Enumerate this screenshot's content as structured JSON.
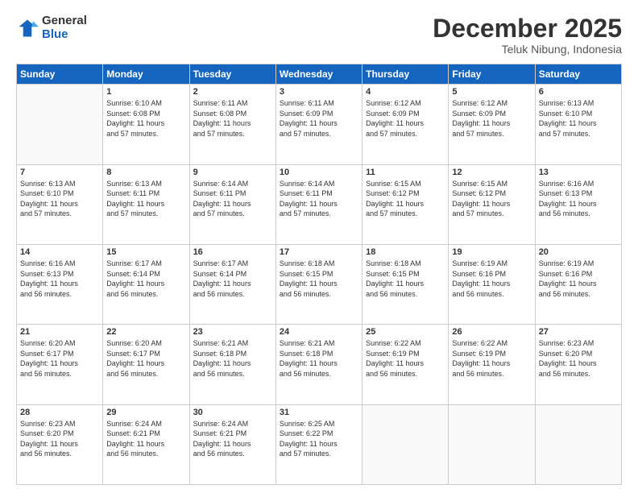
{
  "logo": {
    "general": "General",
    "blue": "Blue"
  },
  "title": "December 2025",
  "subtitle": "Teluk Nibung, Indonesia",
  "weekdays": [
    "Sunday",
    "Monday",
    "Tuesday",
    "Wednesday",
    "Thursday",
    "Friday",
    "Saturday"
  ],
  "weeks": [
    [
      {
        "day": "",
        "info": ""
      },
      {
        "day": "1",
        "info": "Sunrise: 6:10 AM\nSunset: 6:08 PM\nDaylight: 11 hours\nand 57 minutes."
      },
      {
        "day": "2",
        "info": "Sunrise: 6:11 AM\nSunset: 6:08 PM\nDaylight: 11 hours\nand 57 minutes."
      },
      {
        "day": "3",
        "info": "Sunrise: 6:11 AM\nSunset: 6:09 PM\nDaylight: 11 hours\nand 57 minutes."
      },
      {
        "day": "4",
        "info": "Sunrise: 6:12 AM\nSunset: 6:09 PM\nDaylight: 11 hours\nand 57 minutes."
      },
      {
        "day": "5",
        "info": "Sunrise: 6:12 AM\nSunset: 6:09 PM\nDaylight: 11 hours\nand 57 minutes."
      },
      {
        "day": "6",
        "info": "Sunrise: 6:13 AM\nSunset: 6:10 PM\nDaylight: 11 hours\nand 57 minutes."
      }
    ],
    [
      {
        "day": "7",
        "info": "Sunrise: 6:13 AM\nSunset: 6:10 PM\nDaylight: 11 hours\nand 57 minutes."
      },
      {
        "day": "8",
        "info": "Sunrise: 6:13 AM\nSunset: 6:11 PM\nDaylight: 11 hours\nand 57 minutes."
      },
      {
        "day": "9",
        "info": "Sunrise: 6:14 AM\nSunset: 6:11 PM\nDaylight: 11 hours\nand 57 minutes."
      },
      {
        "day": "10",
        "info": "Sunrise: 6:14 AM\nSunset: 6:11 PM\nDaylight: 11 hours\nand 57 minutes."
      },
      {
        "day": "11",
        "info": "Sunrise: 6:15 AM\nSunset: 6:12 PM\nDaylight: 11 hours\nand 57 minutes."
      },
      {
        "day": "12",
        "info": "Sunrise: 6:15 AM\nSunset: 6:12 PM\nDaylight: 11 hours\nand 57 minutes."
      },
      {
        "day": "13",
        "info": "Sunrise: 6:16 AM\nSunset: 6:13 PM\nDaylight: 11 hours\nand 56 minutes."
      }
    ],
    [
      {
        "day": "14",
        "info": "Sunrise: 6:16 AM\nSunset: 6:13 PM\nDaylight: 11 hours\nand 56 minutes."
      },
      {
        "day": "15",
        "info": "Sunrise: 6:17 AM\nSunset: 6:14 PM\nDaylight: 11 hours\nand 56 minutes."
      },
      {
        "day": "16",
        "info": "Sunrise: 6:17 AM\nSunset: 6:14 PM\nDaylight: 11 hours\nand 56 minutes."
      },
      {
        "day": "17",
        "info": "Sunrise: 6:18 AM\nSunset: 6:15 PM\nDaylight: 11 hours\nand 56 minutes."
      },
      {
        "day": "18",
        "info": "Sunrise: 6:18 AM\nSunset: 6:15 PM\nDaylight: 11 hours\nand 56 minutes."
      },
      {
        "day": "19",
        "info": "Sunrise: 6:19 AM\nSunset: 6:16 PM\nDaylight: 11 hours\nand 56 minutes."
      },
      {
        "day": "20",
        "info": "Sunrise: 6:19 AM\nSunset: 6:16 PM\nDaylight: 11 hours\nand 56 minutes."
      }
    ],
    [
      {
        "day": "21",
        "info": "Sunrise: 6:20 AM\nSunset: 6:17 PM\nDaylight: 11 hours\nand 56 minutes."
      },
      {
        "day": "22",
        "info": "Sunrise: 6:20 AM\nSunset: 6:17 PM\nDaylight: 11 hours\nand 56 minutes."
      },
      {
        "day": "23",
        "info": "Sunrise: 6:21 AM\nSunset: 6:18 PM\nDaylight: 11 hours\nand 56 minutes."
      },
      {
        "day": "24",
        "info": "Sunrise: 6:21 AM\nSunset: 6:18 PM\nDaylight: 11 hours\nand 56 minutes."
      },
      {
        "day": "25",
        "info": "Sunrise: 6:22 AM\nSunset: 6:19 PM\nDaylight: 11 hours\nand 56 minutes."
      },
      {
        "day": "26",
        "info": "Sunrise: 6:22 AM\nSunset: 6:19 PM\nDaylight: 11 hours\nand 56 minutes."
      },
      {
        "day": "27",
        "info": "Sunrise: 6:23 AM\nSunset: 6:20 PM\nDaylight: 11 hours\nand 56 minutes."
      }
    ],
    [
      {
        "day": "28",
        "info": "Sunrise: 6:23 AM\nSunset: 6:20 PM\nDaylight: 11 hours\nand 56 minutes."
      },
      {
        "day": "29",
        "info": "Sunrise: 6:24 AM\nSunset: 6:21 PM\nDaylight: 11 hours\nand 56 minutes."
      },
      {
        "day": "30",
        "info": "Sunrise: 6:24 AM\nSunset: 6:21 PM\nDaylight: 11 hours\nand 56 minutes."
      },
      {
        "day": "31",
        "info": "Sunrise: 6:25 AM\nSunset: 6:22 PM\nDaylight: 11 hours\nand 57 minutes."
      },
      {
        "day": "",
        "info": ""
      },
      {
        "day": "",
        "info": ""
      },
      {
        "day": "",
        "info": ""
      }
    ]
  ]
}
